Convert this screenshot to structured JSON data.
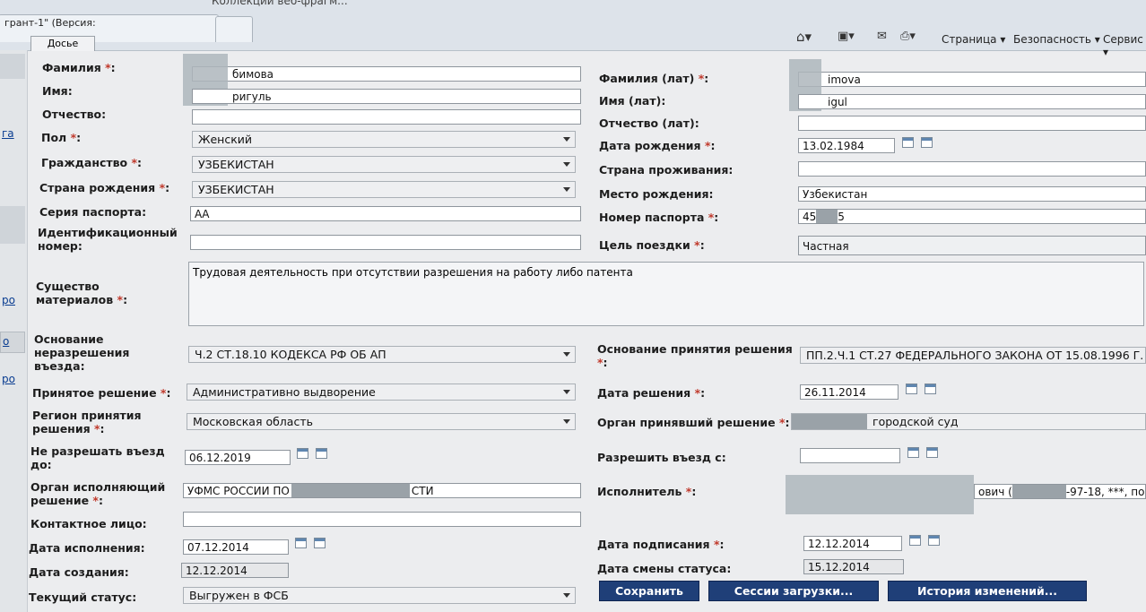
{
  "browser": {
    "window_title": "грант-1\" (Версия:",
    "bookmarks_partial": "Коллекции веб-фрагм...",
    "menu_page": "Страница",
    "menu_security": "Безопасность",
    "menu_service": "Сервис"
  },
  "left_links": [
    "га",
    "ро",
    "о",
    "ро"
  ],
  "form": {
    "top_tab": "Досье",
    "surname": {
      "label": "Фамилия",
      "value": "бимова"
    },
    "name": {
      "label": "Имя:",
      "value": "ригуль"
    },
    "patronymic": {
      "label": "Отчество:",
      "value": ""
    },
    "gender": {
      "label": "Пол",
      "value": "Женский"
    },
    "citizenship": {
      "label": "Гражданство",
      "value": "УЗБЕКИСТАН"
    },
    "birth_country": {
      "label": "Страна рождения",
      "value": "УЗБЕКИСТАН"
    },
    "passport_series": {
      "label": "Серия паспорта:",
      "value": "АА"
    },
    "id_number": {
      "label_1": "Идентификационный",
      "label_2": "номер:",
      "value": ""
    },
    "essence": {
      "label_1": "Существо",
      "label_2": "материалов",
      "value": "Трудовая деятельность при отсутствии разрешения на работу либо патента"
    },
    "refusal_basis": {
      "label_1": "Основание",
      "label_2": "неразрешения",
      "label_3": "въезда:",
      "value": "Ч.2 СТ.18.10 КОДЕКСА РФ ОБ АП"
    },
    "decision": {
      "label": "Принятое решение",
      "value": "Административно выдворение"
    },
    "region": {
      "label_1": "Регион принятия",
      "label_2": "решения",
      "value": "Московская область"
    },
    "no_entry_until": {
      "label_1": "Не разрешать въезд",
      "label_2": "до:",
      "value": "06.12.2019"
    },
    "executing_body": {
      "label_1": "Орган исполняющий",
      "label_2": "решение",
      "value_start": "УФМС РОССИИ ПО",
      "value_end": "СТИ"
    },
    "contact": {
      "label": "Контактное лицо:",
      "value": ""
    },
    "execution_date": {
      "label": "Дата исполнения:",
      "value": "07.12.2014"
    },
    "creation_date": {
      "label": "Дата создания:",
      "value": "12.12.2014"
    },
    "status": {
      "label": "Текущий статус:",
      "value": "Выгружен в ФСБ"
    },
    "surname_lat": {
      "label": "Фамилия (лат)",
      "value": "imova"
    },
    "name_lat": {
      "label": "Имя (лат):",
      "value": "igul"
    },
    "patronymic_lat": {
      "label": "Отчество (лат):",
      "value": ""
    },
    "birth_date": {
      "label": "Дата рождения",
      "value": "13.02.1984"
    },
    "residence_country": {
      "label": "Страна проживания:",
      "value": ""
    },
    "birth_place": {
      "label": "Место рождения:",
      "value": "Узбекистан"
    },
    "passport_number": {
      "label": "Номер паспорта",
      "value_start": "45",
      "value_end": "5"
    },
    "trip_purpose": {
      "label": "Цель поездки",
      "value": "Частная"
    },
    "decision_basis": {
      "label": "Основание принятия решения",
      "value": "ПП.2.Ч.1 СТ.27 ФЕДЕРАЛЬНОГО ЗАКОНА ОТ 15.08.1996 Г. №"
    },
    "decision_date": {
      "label": "Дата решения",
      "value": "26.11.2014"
    },
    "deciding_body": {
      "label": "Орган принявший решение",
      "value": "городской суд"
    },
    "allow_entry_from": {
      "label": "Разрешить въезд с:",
      "value": ""
    },
    "executor": {
      "label": "Исполнитель",
      "value_mid": "ович (",
      "value_end": "-97-18, ***, по"
    },
    "signing_date": {
      "label": "Дата подписания",
      "value": "12.12.2014"
    },
    "status_change_date": {
      "label": "Дата смены статуса:",
      "value": "15.12.2014"
    },
    "required_mark": "*"
  },
  "buttons": {
    "save": "Сохранить",
    "sessions": "Сессии загрузки...",
    "history": "История изменений..."
  }
}
